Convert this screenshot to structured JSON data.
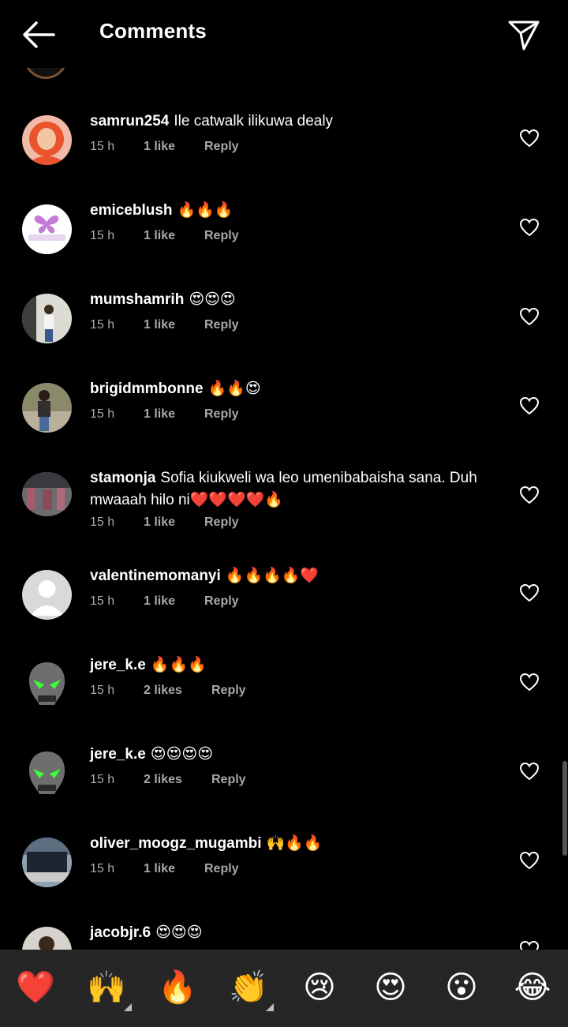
{
  "header": {
    "title": "Comments",
    "back_icon": "back-arrow-icon",
    "send_icon": "paper-plane-icon"
  },
  "comments": [
    {
      "username": "samrun254",
      "text": "Ile catwalk ilikuwa dealy",
      "time": "15 h",
      "likes": "1 like",
      "reply": "Reply",
      "avatar": "orange hijab"
    },
    {
      "username": "emiceblush",
      "text": "🔥🔥🔥",
      "time": "15 h",
      "likes": "1 like",
      "reply": "Reply",
      "avatar": "butterfly logo"
    },
    {
      "username": "mumshamrih",
      "text": "😍😍😍",
      "time": "15 h",
      "likes": "1 like",
      "reply": "Reply",
      "avatar": "person standing"
    },
    {
      "username": "brigidmmbonne",
      "text": "🔥🔥😍",
      "time": "15 h",
      "likes": "1 like",
      "reply": "Reply",
      "avatar": "person outdoors"
    },
    {
      "username": "stamonja",
      "text": "Sofia kiukweli wa leo umenibabaisha sana.  Duh mwaaah hilo ni❤️❤️❤️❤️🔥",
      "time": "15 h",
      "likes": "1 like",
      "reply": "Reply",
      "avatar": "group photo"
    },
    {
      "username": "valentinemomanyi",
      "text": "🔥🔥🔥🔥❤️",
      "time": "15 h",
      "likes": "1 like",
      "reply": "Reply",
      "avatar": "default"
    },
    {
      "username": "jere_k.e",
      "text": "🔥🔥🔥",
      "time": "15 h",
      "likes": "2 likes",
      "reply": "Reply",
      "avatar": "skull"
    },
    {
      "username": "jere_k.e",
      "text": "😍😍😍😍",
      "time": "15 h",
      "likes": "2 likes",
      "reply": "Reply",
      "avatar": "skull"
    },
    {
      "username": "oliver_moogz_mugambi",
      "text": "🙌🔥🔥",
      "time": "15 h",
      "likes": "1 like",
      "reply": "Reply",
      "avatar": "laptop"
    },
    {
      "username": "jacobjr.6",
      "text": "😍😍😍",
      "time": "",
      "likes": "",
      "reply": "",
      "avatar": "person"
    }
  ],
  "reactions": [
    "❤️",
    "🙌",
    "🔥",
    "👏",
    "😢",
    "😍",
    "😮",
    "😂"
  ],
  "colors": {
    "background": "#000000",
    "meta_text": "#a8a8a8",
    "reaction_bar": "#262626"
  }
}
